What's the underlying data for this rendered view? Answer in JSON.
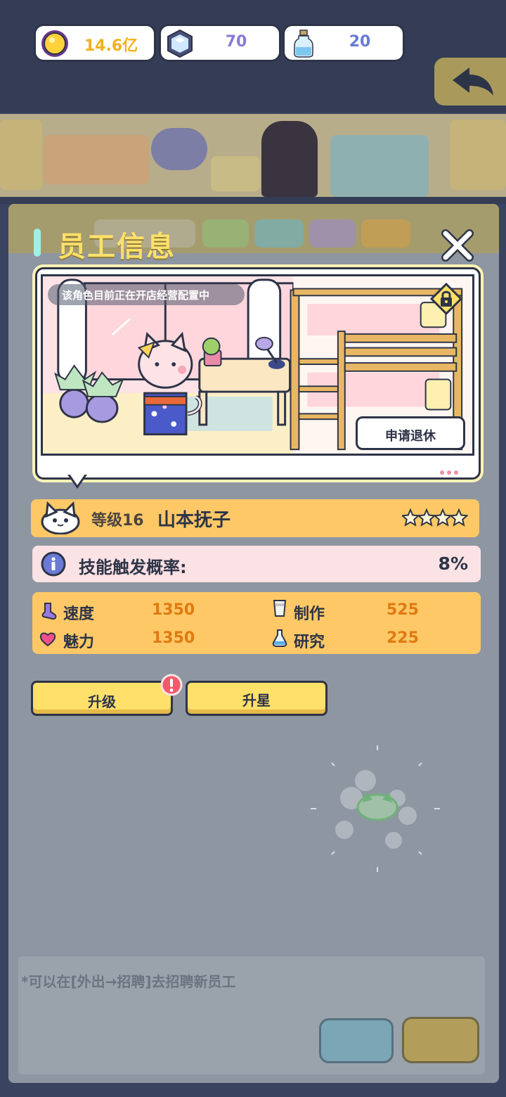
{
  "currency": {
    "gold": {
      "icon": "gold-coin-icon",
      "value": "14.6亿",
      "color": "#f2b21c"
    },
    "gem": {
      "icon": "hexagon-gem-icon",
      "value": "70",
      "color": "#8a7ad6"
    },
    "potion": {
      "icon": "bottle-potion-icon",
      "value": "20",
      "color": "#6a7ad6"
    }
  },
  "panel": {
    "title": "员工信息",
    "close_icon": "close-icon"
  },
  "scene": {
    "status_text": "该角色目前正在开店经营配置中",
    "retire_label": "申请退休",
    "lock_icon": "lock-icon"
  },
  "employee": {
    "level_text": "等级16",
    "name": "山本抚子",
    "stars": 4,
    "skill_label": "技能触发概率:",
    "skill_value": "8%"
  },
  "stats": [
    {
      "icon": "sock-icon",
      "label": "速度",
      "value": "1350"
    },
    {
      "icon": "heart-icon",
      "label": "魅力",
      "value": "1350"
    },
    {
      "icon": "cup-icon",
      "label": "制作",
      "value": "525"
    },
    {
      "icon": "flask-icon",
      "label": "研究",
      "value": "225"
    }
  ],
  "actions": {
    "upgrade_label": "升级",
    "star_up_label": "升星"
  },
  "background": {
    "hint_text": "*可以在[外出→招聘]去招聘新员工"
  },
  "colors": {
    "accent_yellow": "#ffe06a",
    "orange_bar": "#ffc867",
    "pink_bar": "#fbe2e4",
    "value_orange": "#e07a10",
    "outline": "#2e3447"
  }
}
